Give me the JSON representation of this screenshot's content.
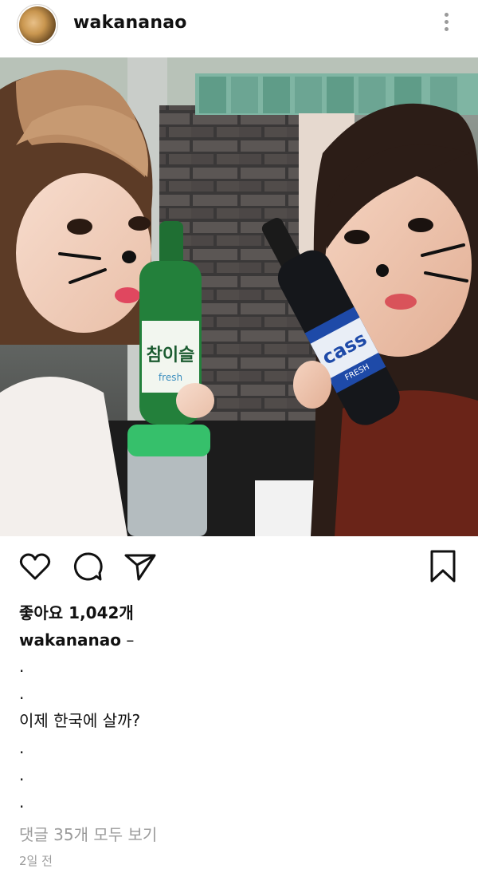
{
  "post": {
    "username": "wakananao",
    "avatar_icon": "profile-photo-icon",
    "likes_text": "좋아요 1,042개",
    "caption_user": "wakananao",
    "caption_lines": [
      " –",
      ".",
      ".",
      "이제 한국에 살까?",
      ".",
      ".",
      "."
    ],
    "comments_link": "댓글 35개 모두 보기",
    "time_ago": "2일 전"
  },
  "photo": {
    "soju_label": "참이슬",
    "soju_sub": "fresh",
    "beer_label": "cass",
    "beer_sub": "FRESH"
  },
  "icons": {
    "more": "more-vertical-icon",
    "user_tag": "person-icon",
    "like": "heart-icon",
    "comment": "comment-icon",
    "share": "send-icon",
    "save": "bookmark-icon"
  },
  "colors": {
    "text": "#111111",
    "muted": "#9b9b9b",
    "background": "#ffffff"
  }
}
